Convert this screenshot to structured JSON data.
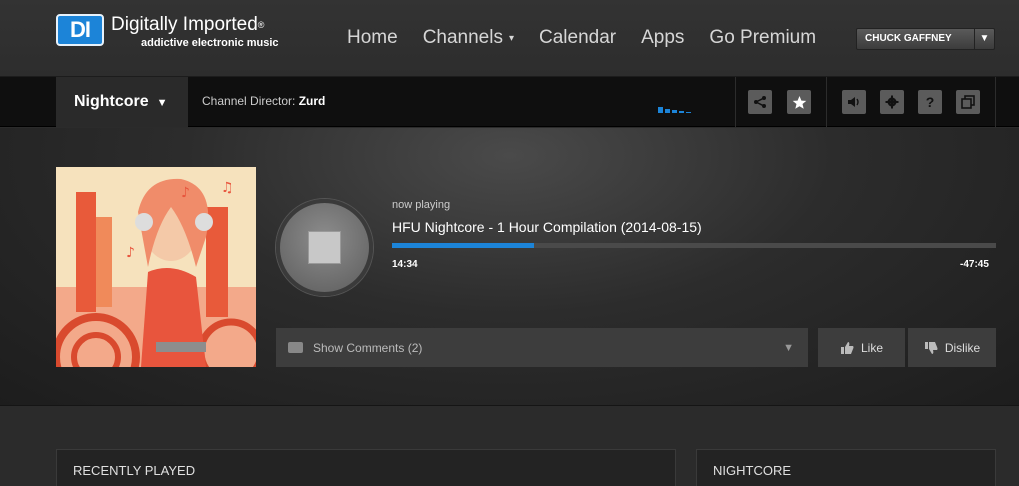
{
  "brand": {
    "logo_mark": "DI",
    "name": "Digitally Imported",
    "registered": "®",
    "tagline": "addictive electronic music",
    "accent": "#1c84d8"
  },
  "nav": {
    "items": [
      {
        "label": "Home"
      },
      {
        "label": "Channels",
        "caret": "▾"
      },
      {
        "label": "Calendar"
      },
      {
        "label": "Apps"
      },
      {
        "label": "Go Premium"
      }
    ]
  },
  "user": {
    "name": "CHUCK GAFFNEY",
    "caret": "▼"
  },
  "channel_bar": {
    "channel": "Nightcore",
    "caret": "▼",
    "director_prefix": "Channel Director:",
    "director": "Zurd",
    "eq_levels": [
      0.6,
      0.4,
      0.3,
      0.15,
      0.1
    ],
    "icons": [
      "share-icon",
      "favorite-star-icon",
      "volume-icon",
      "settings-gear-icon",
      "help-icon",
      "popout-icon"
    ]
  },
  "player": {
    "now_playing_label": "now playing",
    "track_title": "HFU Nightcore - 1 Hour Compilation (2014-08-15)",
    "progress": 0.235,
    "elapsed": "14:34",
    "remaining": "-47:45",
    "comments_label": "Show Comments",
    "comments_count": "(2)",
    "like_label": "Like",
    "dislike_label": "Dislike"
  },
  "panels": {
    "recently_played": "RECENTLY PLAYED",
    "channel_panel": "NIGHTCORE"
  }
}
